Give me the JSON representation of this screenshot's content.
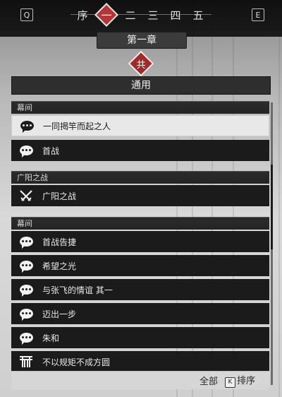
{
  "nav": {
    "prev_key": "Q",
    "next_key": "E",
    "tabs": [
      {
        "label": "序",
        "active": false
      },
      {
        "label": "一",
        "active": true
      },
      {
        "label": "二",
        "active": false
      },
      {
        "label": "三",
        "active": false
      },
      {
        "label": "四",
        "active": false
      },
      {
        "label": "五",
        "active": false
      }
    ],
    "accent_color": "#b33434"
  },
  "chapter_title": "第一章",
  "faction_badge": "共",
  "section_title": "通用",
  "list": {
    "groups": [
      {
        "header": "幕间",
        "items": [
          {
            "label": "一同揭竿而起之人",
            "icon": "speech-bubble-icon",
            "selected": true
          },
          {
            "label": "首战",
            "icon": "speech-bubble-icon",
            "selected": false
          }
        ]
      },
      {
        "header": "广阳之战",
        "items": [
          {
            "label": "广阳之战",
            "icon": "crossed-swords-icon",
            "selected": false
          }
        ]
      },
      {
        "header": "幕间",
        "items": [
          {
            "label": "首战告捷",
            "icon": "speech-bubble-icon",
            "selected": false
          },
          {
            "label": "希望之光",
            "icon": "speech-bubble-icon",
            "selected": false
          },
          {
            "label": "与张飞的情谊 其一",
            "icon": "speech-bubble-icon",
            "selected": false
          },
          {
            "label": "迈出一步",
            "icon": "speech-bubble-icon",
            "selected": false
          },
          {
            "label": "朱和",
            "icon": "speech-bubble-icon",
            "selected": false
          },
          {
            "label": "不以规矩不成方圆",
            "icon": "gate-icon",
            "selected": false
          }
        ]
      }
    ]
  },
  "footer": {
    "filter_label": "全部",
    "sort_key": "K",
    "sort_label": "排序"
  }
}
